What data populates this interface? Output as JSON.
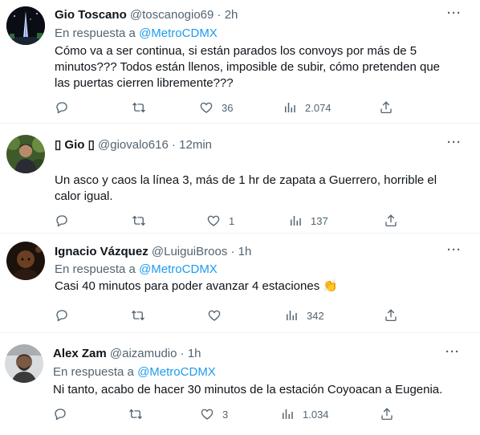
{
  "reply_prefix": "En respuesta a",
  "tweets": [
    {
      "name": "Gio Toscano",
      "handle": "@toscanogio69",
      "time": "2h",
      "reply_to": "@MetroCDMX",
      "text": "Cómo va a ser continua, si están parados los convoys por más de 5 minutos??? Todos están llenos, imposible de subir, cómo pretenden que las puertas cierren libremente???",
      "likes": "36",
      "views": "2.074",
      "replies": "",
      "retweets": ""
    },
    {
      "name": "\u0000 Gio \u0000",
      "name_display": "▯ Gio ▯",
      "handle": "@giovalo616",
      "time": "12min",
      "text": "Un asco y caos la línea 3, más de 1 hr de zapata a Guerrero, horrible el calor igual.",
      "likes": "1",
      "views": "137",
      "replies": "",
      "retweets": ""
    },
    {
      "name": "Ignacio Vázquez",
      "handle": "@LuiguiBroos",
      "time": "1h",
      "reply_to": "@MetroCDMX",
      "text": "Casi 40 minutos para poder avanzar 4 estaciones",
      "emoji": "👏",
      "likes": "",
      "views": "342",
      "replies": "",
      "retweets": ""
    },
    {
      "name": "Alex Zam",
      "handle": "@aizamudio",
      "time": "1h",
      "reply_to": "@MetroCDMX",
      "text": "Ni tanto, acabo de hacer 30 minutos de la estación Coyoacan a Eugenia.",
      "likes": "3",
      "views": "1.034",
      "replies": "",
      "retweets": ""
    }
  ],
  "more_label": "···",
  "separator": "·",
  "colors": {
    "link": "#1d9bf0",
    "muted": "#536471",
    "text": "#0f1419",
    "divider": "#eff3f4"
  }
}
